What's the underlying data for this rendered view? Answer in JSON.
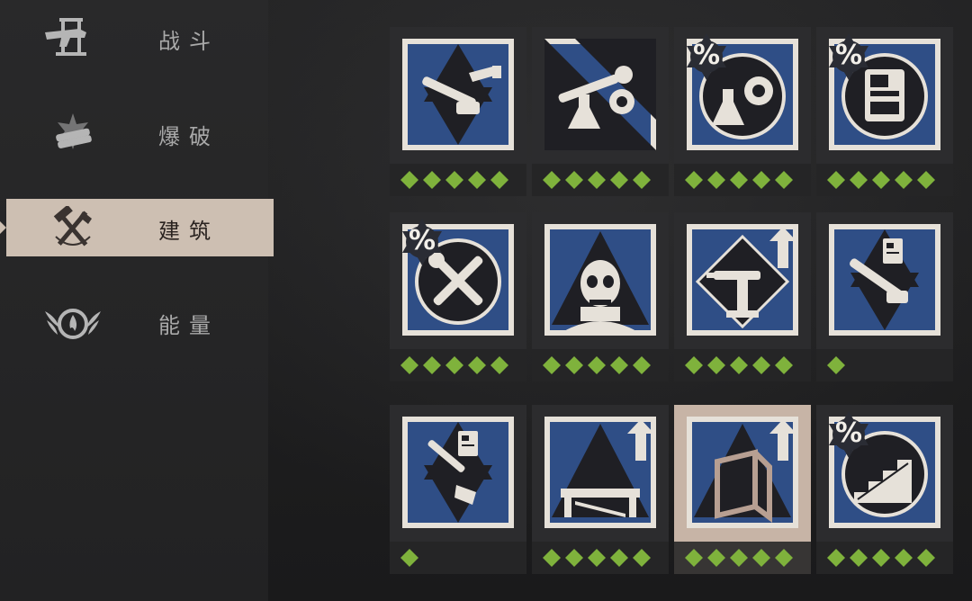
{
  "categories": [
    {
      "label": "战斗",
      "icon": "combat-icon",
      "selected": false
    },
    {
      "label": "爆破",
      "icon": "explosives-icon",
      "selected": false
    },
    {
      "label": "建筑",
      "icon": "construction-icon",
      "selected": true
    },
    {
      "label": "能量",
      "icon": "energy-icon",
      "selected": false
    }
  ],
  "colors": {
    "rank_pip": "#7fb23c",
    "perk_blue": "#2f4e86",
    "perk_frame": "#e6e1d9",
    "selected_tab": "#cdbfb2"
  },
  "perks": [
    {
      "icon": "chainsaw-tools-perk-icon",
      "rank": 5,
      "percent_badge": false,
      "upgrade_arrow": false,
      "selected": false
    },
    {
      "icon": "wrench-gear-flask-perk-icon",
      "rank": 5,
      "percent_badge": false,
      "upgrade_arrow": false,
      "selected": false
    },
    {
      "icon": "flask-gear-perk-icon",
      "rank": 5,
      "percent_badge": true,
      "percent_text": "%",
      "upgrade_arrow": false,
      "selected": false
    },
    {
      "icon": "workbench-panel-perk-icon",
      "rank": 5,
      "percent_badge": true,
      "percent_text": "%",
      "upgrade_arrow": false,
      "selected": false
    },
    {
      "icon": "wrench-screwdriver-perk-icon",
      "rank": 5,
      "percent_badge": true,
      "percent_text": "%",
      "upgrade_arrow": false,
      "selected": false
    },
    {
      "icon": "skull-perk-icon",
      "rank": 5,
      "percent_badge": false,
      "upgrade_arrow": false,
      "selected": false
    },
    {
      "icon": "turret-perk-icon",
      "rank": 5,
      "percent_badge": false,
      "upgrade_arrow": true,
      "selected": false
    },
    {
      "icon": "chainsaw-blueprint-perk-icon",
      "rank": 1,
      "percent_badge": false,
      "upgrade_arrow": false,
      "selected": false
    },
    {
      "icon": "drill-blueprint-perk-icon",
      "rank": 1,
      "percent_badge": false,
      "upgrade_arrow": false,
      "selected": false
    },
    {
      "icon": "platform-perk-icon",
      "rank": 5,
      "percent_badge": false,
      "upgrade_arrow": true,
      "selected": false
    },
    {
      "icon": "doorframe-perk-icon",
      "rank": 5,
      "percent_badge": false,
      "upgrade_arrow": true,
      "selected": true
    },
    {
      "icon": "stairs-perk-icon",
      "rank": 5,
      "percent_badge": true,
      "percent_text": "%",
      "upgrade_arrow": false,
      "selected": false
    }
  ]
}
